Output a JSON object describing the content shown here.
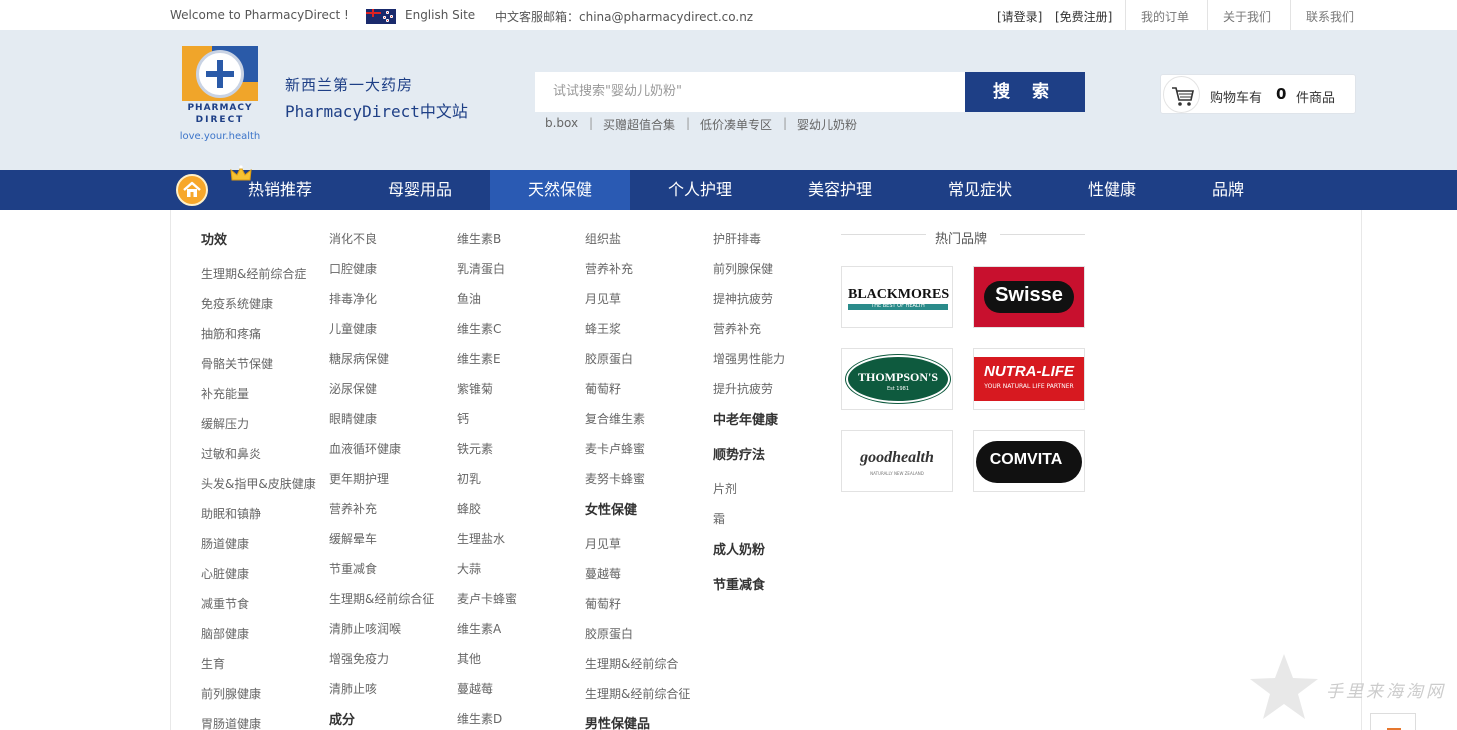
{
  "topbar": {
    "welcome": "Welcome to PharmacyDirect !",
    "english_site": "English Site",
    "email": "中文客服邮箱：china@pharmacydirect.co.nz",
    "login": "[请登录]",
    "register": "[免费注册]",
    "my_orders": "我的订单",
    "about_us": "关于我们",
    "contact_us": "联系我们"
  },
  "header": {
    "logo_line1": "PHARMACY",
    "logo_line2": "DIRECT",
    "logo_tagline": "love.your.health",
    "site_cn": "新西兰第一大药房",
    "site_en": "PharmacyDirect中文站"
  },
  "search": {
    "placeholder": "试试搜索\"婴幼儿奶粉\"",
    "button": "搜 索",
    "hot_keywords": [
      "b.box",
      "买赠超值合集",
      "低价凑单专区",
      "婴幼儿奶粉"
    ],
    "sep": "|"
  },
  "cart": {
    "label": "购物车有",
    "count": "0",
    "unit": "件商品"
  },
  "nav": {
    "items": [
      "热销推荐",
      "母婴用品",
      "天然保健",
      "个人护理",
      "美容护理",
      "常见症状",
      "性健康",
      "品牌"
    ],
    "active_index": 2
  },
  "menu": {
    "col1": {
      "heading": "功效",
      "links": [
        "生理期&经前综合症",
        "免疫系统健康",
        "抽筋和疼痛",
        "骨骼关节保健",
        "补充能量",
        "缓解压力",
        "过敏和鼻炎",
        "头发&指甲&皮肤健康",
        "助眠和镇静",
        "肠道健康",
        "心脏健康",
        "减重节食",
        "脑部健康",
        "生育",
        "前列腺健康",
        "胃肠道健康"
      ]
    },
    "col2": {
      "links": [
        "消化不良",
        "口腔健康",
        "排毒净化",
        "儿童健康",
        "糖尿病保健",
        "泌尿保健",
        "眼睛健康",
        "血液循环健康",
        "更年期护理",
        "营养补充",
        "缓解晕车",
        "节重减食",
        "生理期&经前综合征",
        "清肺止咳润喉",
        "增强免疫力",
        "清肺止咳"
      ],
      "heading_bottom": "成分"
    },
    "col3": {
      "links": [
        "维生素B",
        "乳清蛋白",
        "鱼油",
        "维生素C",
        "维生素E",
        "紫锥菊",
        "钙",
        "铁元素",
        "初乳",
        "蜂胶",
        "生理盐水",
        "大蒜",
        "麦卢卡蜂蜜",
        "维生素A",
        "其他",
        "蔓越莓",
        "维生素D"
      ]
    },
    "col4": {
      "links_top": [
        "组织盐",
        "营养补充",
        "月见草",
        "蜂王浆",
        "胶原蛋白",
        "葡萄籽",
        "复合维生素",
        "麦卡卢蜂蜜",
        "麦努卡蜂蜜"
      ],
      "heading_women": "女性保健",
      "links_women": [
        "月见草",
        "蔓越莓",
        "葡萄籽",
        "胶原蛋白",
        "生理期&经前综合",
        "生理期&经前综合征"
      ],
      "heading_men": "男性保健品"
    },
    "col5": {
      "links_top": [
        "护肝排毒",
        "前列腺保健",
        "提神抗疲劳",
        "营养补充",
        "增强男性能力",
        "提升抗疲劳"
      ],
      "heading_elder": "中老年健康",
      "heading_natural": "顺势疗法",
      "links_natural": [
        "片剂",
        "霜"
      ],
      "heading_adult_milk": "成人奶粉",
      "heading_diet": "节重减食"
    }
  },
  "brands": {
    "title": "热门品牌",
    "items": [
      "BLACKMORES",
      "Swisse",
      "THOMPSON'S",
      "NUTRA-LIFE",
      "goodhealth",
      "COMVITA"
    ],
    "blackmores_sub": "THE BEST OF HEALTH",
    "thompsons_sub": "Est 1981",
    "nutralife_sub": "YOUR NATURAL LIFE PARTNER",
    "goodhealth_sub": "NATURALLY NEW ZEALAND"
  },
  "watermark": "手里来海淘网",
  "colors": {
    "nav_bg": "#1e3f86",
    "nav_active": "#2a5ab3",
    "header_bg": "#e4ebf2",
    "accent_orange": "#f7a72a"
  }
}
